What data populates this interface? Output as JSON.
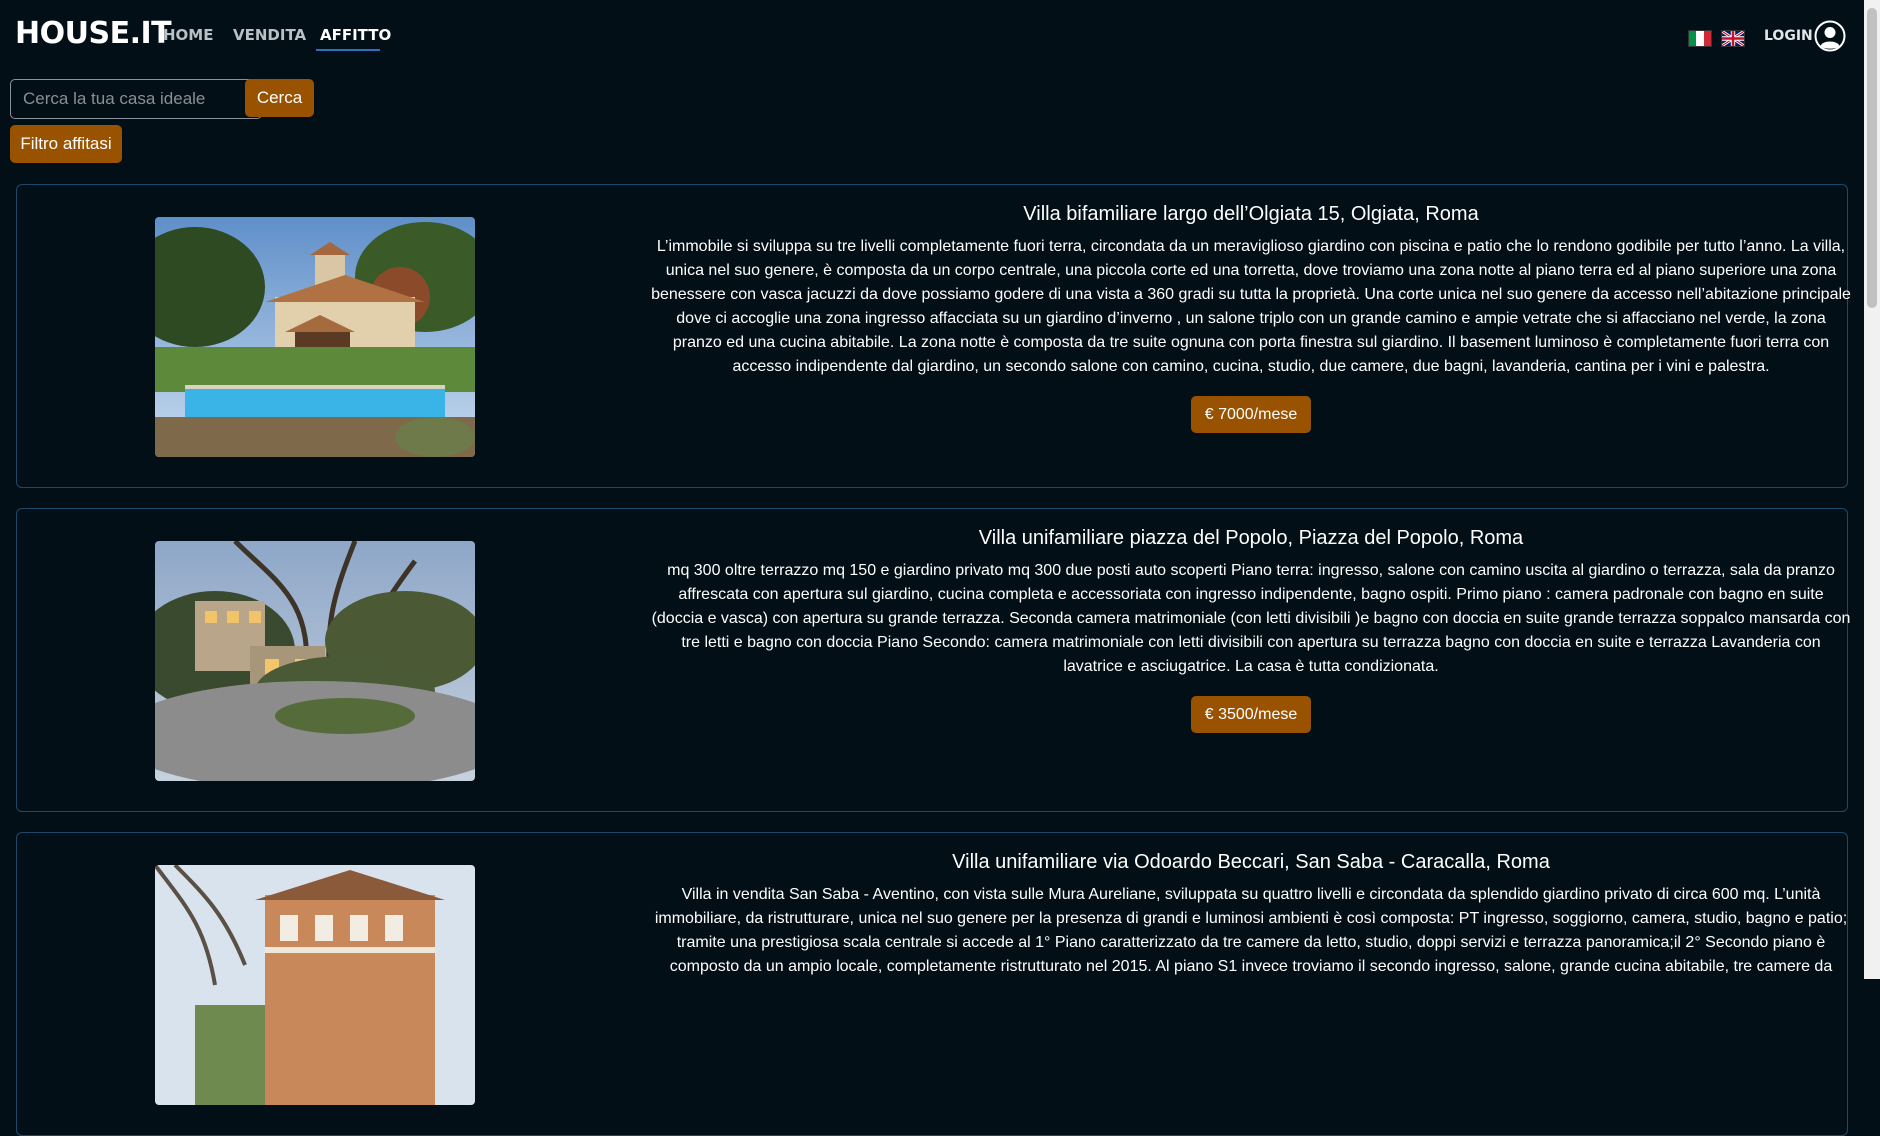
{
  "brand": "HOUSE.IT",
  "nav": {
    "home": "HOME",
    "vendita": "VENDITA",
    "affitto": "AFFITTO",
    "login": "LOGIN"
  },
  "search": {
    "placeholder": "Cerca la tua casa ideale",
    "button": "Cerca"
  },
  "filter_button": "Filtro affitasi",
  "colors": {
    "accent": "#995300",
    "background": "#020f17",
    "card_border": "#1c4a6e"
  },
  "listings": [
    {
      "title": "Villa bifamiliare largo dell’Olgiata 15, Olgiata, Roma",
      "description": "L’immobile si sviluppa su tre livelli completamente fuori terra, circondata da un meraviglioso giardino con piscina e patio che lo rendono godibile per tutto l’anno. La villa, unica nel suo genere, è composta da un corpo centrale, una piccola corte ed una torretta, dove troviamo una zona notte al piano terra ed al piano superiore una zona benessere con vasca jacuzzi da dove possiamo godere di una vista a 360 gradi su tutta la proprietà. Una corte unica nel suo genere da accesso nell’abitazione principale dove ci accoglie una zona ingresso affacciata su un giardino d’inverno , un salone triplo con un grande camino e ampie vetrate che si affacciano nel verde, la zona pranzo ed una cucina abitabile. La zona notte è composta da tre suite ognuna con porta finestra sul giardino. Il basement luminoso è completamente fuori terra con accesso indipendente dal giardino, un secondo salone con camino, cucina, studio, due camere, due bagni, lavanderia, cantina per i vini e palestra.",
      "price": "€ 7000/mese"
    },
    {
      "title": "Villa unifamiliare piazza del Popolo, Piazza del Popolo, Roma",
      "description": "mq 300 oltre terrazzo mq 150 e giardino privato mq 300 due posti auto scoperti Piano terra: ingresso, salone con camino uscita al giardino o terrazza, sala da pranzo affrescata con apertura sul giardino, cucina completa e accessoriata con ingresso indipendente, bagno ospiti. Primo piano : camera padronale con bagno en suite (doccia e vasca) con apertura su grande terrazza. Seconda camera matrimoniale (con letti divisibili )e bagno con doccia en suite grande terrazza soppalco mansarda con tre letti e bagno con doccia Piano Secondo: camera matrimoniale con letti divisibili con apertura su terrazza bagno con doccia en suite e terrazza Lavanderia con lavatrice e asciugatrice. La casa è tutta condizionata.",
      "price": "€ 3500/mese"
    },
    {
      "title": "Villa unifamiliare via Odoardo Beccari, San Saba - Caracalla, Roma",
      "description": "Villa in vendita San Saba - Aventino, con vista sulle Mura Aureliane, sviluppata su quattro livelli e circondata da splendido giardino privato di circa 600 mq. L’unità immobiliare, da ristrutturare, unica nel suo genere per la presenza di grandi e luminosi ambienti è così composta: PT ingresso, soggiorno, camera, studio, bagno e patio; tramite una prestigiosa scala centrale si accede al 1° Piano caratterizzato da tre camere da letto, studio, doppi servizi e terrazza panoramica;il 2° Secondo piano è composto da un ampio locale, completamente ristrutturato nel 2015. Al piano S1 invece troviamo il secondo ingresso, salone, grande cucina abitabile, tre camere da",
      "price": ""
    }
  ]
}
